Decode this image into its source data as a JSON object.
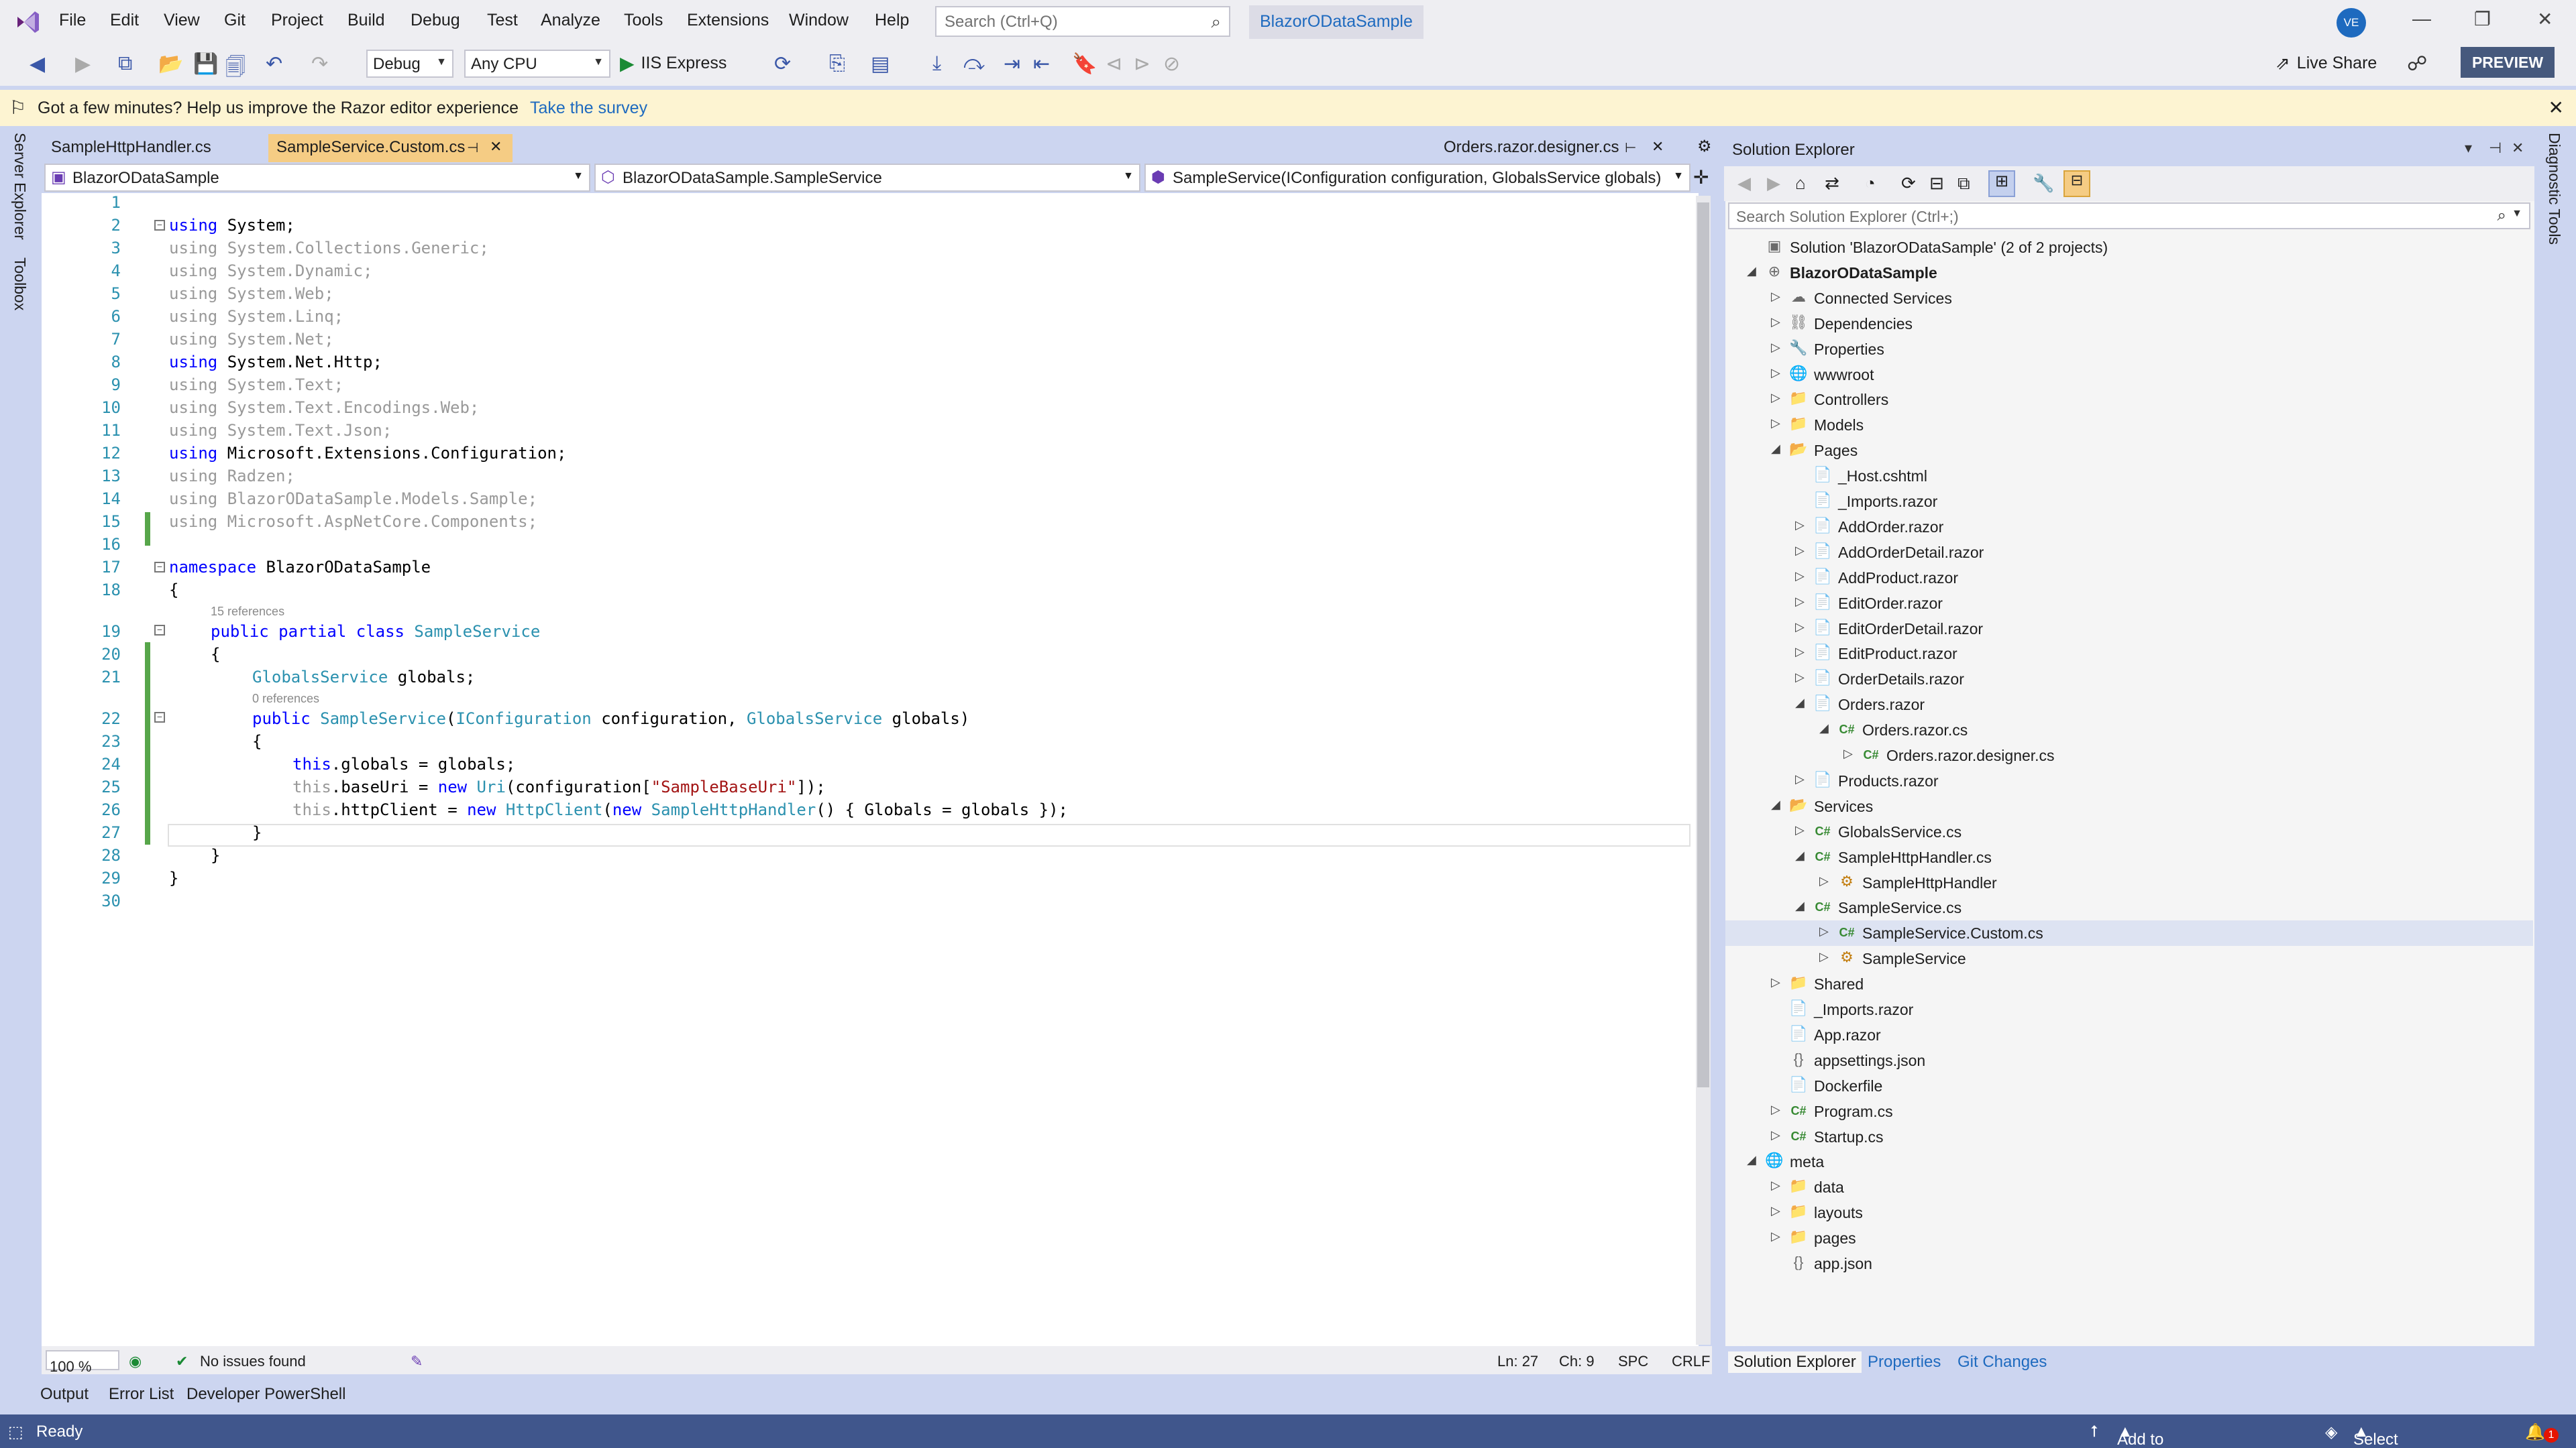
{
  "menubar": {
    "items": [
      "File",
      "Edit",
      "View",
      "Git",
      "Project",
      "Build",
      "Debug",
      "Test",
      "Analyze",
      "Tools",
      "Extensions",
      "Window",
      "Help"
    ],
    "search_placeholder": "Search (Ctrl+Q)",
    "solution_title": "BlazorODataSample",
    "avatar_initials": "VE"
  },
  "toolbar": {
    "config": "Debug",
    "platform": "Any CPU",
    "run_target": "IIS Express",
    "live_share": "Live Share",
    "preview": "PREVIEW"
  },
  "infobar": {
    "message": "Got a few minutes? Help us improve the Razor editor experience",
    "link": "Take the survey"
  },
  "left_rail": [
    "Server Explorer",
    "Toolbox"
  ],
  "right_rail": [
    "Diagnostic Tools"
  ],
  "document_tabs": [
    {
      "label": "SampleHttpHandler.cs",
      "active": false
    },
    {
      "label": "SampleService.Custom.cs",
      "active": true
    },
    {
      "label": "Orders.razor.designer.cs",
      "active": false
    }
  ],
  "nav_bar": {
    "project": "BlazorODataSample",
    "type": "BlazorODataSample.SampleService",
    "member": "SampleService(IConfiguration configuration, GlobalsService globals)"
  },
  "code_lines": [
    {
      "n": "1"
    },
    {
      "n": "2"
    },
    {
      "n": "3"
    },
    {
      "n": "4"
    },
    {
      "n": "5"
    },
    {
      "n": "6"
    },
    {
      "n": "7"
    },
    {
      "n": "8"
    },
    {
      "n": "9"
    },
    {
      "n": "10"
    },
    {
      "n": "11"
    },
    {
      "n": "12"
    },
    {
      "n": "13"
    },
    {
      "n": "14"
    },
    {
      "n": "15"
    },
    {
      "n": "16"
    },
    {
      "n": "17"
    },
    {
      "n": "18"
    },
    {
      "n": "19"
    },
    {
      "n": "20"
    },
    {
      "n": "21"
    },
    {
      "n": "22"
    },
    {
      "n": "23"
    },
    {
      "n": "24"
    },
    {
      "n": "25"
    },
    {
      "n": "26"
    },
    {
      "n": "27"
    },
    {
      "n": "28"
    },
    {
      "n": "29"
    },
    {
      "n": "30"
    }
  ],
  "code": {
    "l2": "using System;",
    "l3": "using System.Collections.Generic;",
    "l4": "using System.Dynamic;",
    "l5": "using System.Web;",
    "l6": "using System.Linq;",
    "l7": "using System.Net;",
    "l8": "using System.Net.Http;",
    "l9": "using System.Text;",
    "l10": "using System.Text.Encodings.Web;",
    "l11": "using System.Text.Json;",
    "l12": "using Microsoft.Extensions.Configuration;",
    "l13": "using Radzen;",
    "l14": "using BlazorODataSample.Models.Sample;",
    "l15": "using Microsoft.AspNetCore.Components;",
    "l17_kw": "namespace",
    "l17_rest": " BlazorODataSample",
    "l18": "{",
    "refs_class": "15 references",
    "l19_kw": "public partial class",
    "l19_ty": " SampleService",
    "l20": "{",
    "l21_ty": "GlobalsService",
    "l21_rest": " globals;",
    "refs_ctor": "0 references",
    "l22_kw": "public",
    "l22_ty": " SampleService",
    "l22_p1": "(",
    "l22_ty2": "IConfiguration",
    "l22_p2": " configuration, ",
    "l22_ty3": "GlobalsService",
    "l22_p3": " globals)",
    "l23": "{",
    "l24_kw": "this",
    "l24_rest": ".globals = globals;",
    "l25_kw": "this",
    "l25_a": ".baseUri = ",
    "l25_new": "new",
    "l25_ty": " Uri",
    "l25_b": "(configuration[",
    "l25_str": "\"SampleBaseUri\"",
    "l25_c": "]);",
    "l26_kw": "this",
    "l26_a": ".httpClient = ",
    "l26_new": "new",
    "l26_ty": " HttpClient",
    "l26_b": "(",
    "l26_new2": "new",
    "l26_ty2": " SampleHttpHandler",
    "l26_c": "() { Globals = globals });",
    "l27": "}",
    "l28": "}",
    "l29": "}"
  },
  "editor_status": {
    "zoom": "100 %",
    "issues": "No issues found",
    "line": "Ln: 27",
    "col": "Ch: 9",
    "spc": "SPC",
    "eol": "CRLF"
  },
  "bottom_tabs": [
    "Output",
    "Error List",
    "Developer PowerShell"
  ],
  "statusbar": {
    "ready": "Ready",
    "source_control": "Add to Source Control",
    "repository": "Select Repository",
    "notifications": "1"
  },
  "solution_explorer": {
    "title": "Solution Explorer",
    "search_placeholder": "Search Solution Explorer (Ctrl+;)",
    "tabs": [
      "Solution Explorer",
      "Properties",
      "Git Changes"
    ],
    "tree": [
      {
        "label": "Solution 'BlazorODataSample' (2 of 2 projects)",
        "depth": 0,
        "arrow": "",
        "icon": "▣"
      },
      {
        "label": "BlazorODataSample",
        "depth": 0,
        "arrow": "◢",
        "icon": "⊕",
        "bold": true
      },
      {
        "label": "Connected Services",
        "depth": 1,
        "arrow": "▷",
        "icon": "☁"
      },
      {
        "label": "Dependencies",
        "depth": 1,
        "arrow": "▷",
        "icon": "⛓"
      },
      {
        "label": "Properties",
        "depth": 1,
        "arrow": "▷",
        "icon": "🔧"
      },
      {
        "label": "wwwroot",
        "depth": 1,
        "arrow": "▷",
        "icon": "🌐"
      },
      {
        "label": "Controllers",
        "depth": 1,
        "arrow": "▷",
        "icon": "📁"
      },
      {
        "label": "Models",
        "depth": 1,
        "arrow": "▷",
        "icon": "📁"
      },
      {
        "label": "Pages",
        "depth": 1,
        "arrow": "◢",
        "icon": "📂"
      },
      {
        "label": "_Host.cshtml",
        "depth": 2,
        "arrow": "",
        "icon": "📄"
      },
      {
        "label": "_Imports.razor",
        "depth": 2,
        "arrow": "",
        "icon": "📄"
      },
      {
        "label": "AddOrder.razor",
        "depth": 2,
        "arrow": "▷",
        "icon": "📄"
      },
      {
        "label": "AddOrderDetail.razor",
        "depth": 2,
        "arrow": "▷",
        "icon": "📄"
      },
      {
        "label": "AddProduct.razor",
        "depth": 2,
        "arrow": "▷",
        "icon": "📄"
      },
      {
        "label": "EditOrder.razor",
        "depth": 2,
        "arrow": "▷",
        "icon": "📄"
      },
      {
        "label": "EditOrderDetail.razor",
        "depth": 2,
        "arrow": "▷",
        "icon": "📄"
      },
      {
        "label": "EditProduct.razor",
        "depth": 2,
        "arrow": "▷",
        "icon": "📄"
      },
      {
        "label": "OrderDetails.razor",
        "depth": 2,
        "arrow": "▷",
        "icon": "📄"
      },
      {
        "label": "Orders.razor",
        "depth": 2,
        "arrow": "◢",
        "icon": "📄"
      },
      {
        "label": "Orders.razor.cs",
        "depth": 3,
        "arrow": "◢",
        "icon": "C#"
      },
      {
        "label": "Orders.razor.designer.cs",
        "depth": 4,
        "arrow": "▷",
        "icon": "C#"
      },
      {
        "label": "Products.razor",
        "depth": 2,
        "arrow": "▷",
        "icon": "📄"
      },
      {
        "label": "Services",
        "depth": 1,
        "arrow": "◢",
        "icon": "📂"
      },
      {
        "label": "GlobalsService.cs",
        "depth": 2,
        "arrow": "▷",
        "icon": "C#"
      },
      {
        "label": "SampleHttpHandler.cs",
        "depth": 2,
        "arrow": "◢",
        "icon": "C#"
      },
      {
        "label": "SampleHttpHandler",
        "depth": 3,
        "arrow": "▷",
        "icon": "⚙"
      },
      {
        "label": "SampleService.cs",
        "depth": 2,
        "arrow": "◢",
        "icon": "C#"
      },
      {
        "label": "SampleService.Custom.cs",
        "depth": 3,
        "arrow": "▷",
        "icon": "C#",
        "selected": true
      },
      {
        "label": "SampleService",
        "depth": 3,
        "arrow": "▷",
        "icon": "⚙"
      },
      {
        "label": "Shared",
        "depth": 1,
        "arrow": "▷",
        "icon": "📁"
      },
      {
        "label": "_Imports.razor",
        "depth": 1,
        "arrow": "",
        "icon": "📄"
      },
      {
        "label": "App.razor",
        "depth": 1,
        "arrow": "",
        "icon": "📄"
      },
      {
        "label": "appsettings.json",
        "depth": 1,
        "arrow": "",
        "icon": "{}"
      },
      {
        "label": "Dockerfile",
        "depth": 1,
        "arrow": "",
        "icon": "📄"
      },
      {
        "label": "Program.cs",
        "depth": 1,
        "arrow": "▷",
        "icon": "C#"
      },
      {
        "label": "Startup.cs",
        "depth": 1,
        "arrow": "▷",
        "icon": "C#"
      },
      {
        "label": "meta",
        "depth": 0,
        "arrow": "◢",
        "icon": "🌐"
      },
      {
        "label": "data",
        "depth": 1,
        "arrow": "▷",
        "icon": "📁"
      },
      {
        "label": "layouts",
        "depth": 1,
        "arrow": "▷",
        "icon": "📁"
      },
      {
        "label": "pages",
        "depth": 1,
        "arrow": "▷",
        "icon": "📁"
      },
      {
        "label": "app.json",
        "depth": 1,
        "arrow": "",
        "icon": "{}"
      }
    ]
  },
  "colors": {
    "accent": "#1e6abf",
    "active_tab": "#f5cc84",
    "statusbar": "#40568c",
    "change_bar": "#57a64a"
  }
}
